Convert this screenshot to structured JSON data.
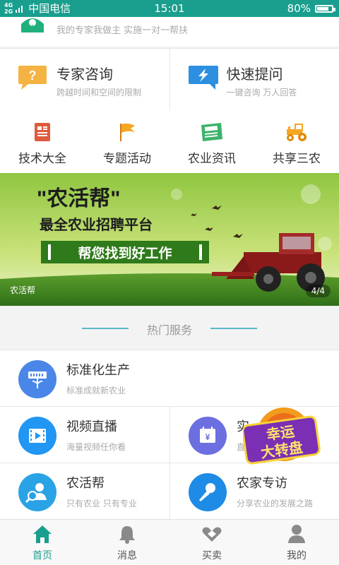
{
  "status": {
    "network": "4G",
    "network2": "2G",
    "carrier": "中国电信",
    "time": "15:01",
    "battery": "80%",
    "battery_level": 0.8
  },
  "top": {
    "slogan": "我的专家我做主 实施一对一帮扶"
  },
  "consult": [
    {
      "title": "专家咨询",
      "sub": "跨越时间和空间的限制",
      "icon": "question-chat-icon"
    },
    {
      "title": "快速提问",
      "sub": "一键咨询 万人回答",
      "icon": "lightning-chat-icon"
    }
  ],
  "categories": [
    {
      "label": "技术大全",
      "icon": "document-icon"
    },
    {
      "label": "专题活动",
      "icon": "flag-icon"
    },
    {
      "label": "农业资讯",
      "icon": "newspaper-icon"
    },
    {
      "label": "共享三农",
      "icon": "tractor-icon"
    }
  ],
  "banner": {
    "headline": "\"农活帮\"",
    "subhead": "最全农业招聘平台",
    "cta": "帮您找到好工作",
    "caption": "农活帮",
    "pager": "4/4"
  },
  "section": {
    "title": "热门服务"
  },
  "services": [
    {
      "title": "标准化生产",
      "sub": "标准成就新农业",
      "icon": "production-icon",
      "color": "#4a86e8"
    },
    {
      "title": "视频直播",
      "sub": "海量视频任你看",
      "icon": "video-icon",
      "color": "#2196f3"
    },
    {
      "title": "实",
      "sub": "直",
      "icon": "calendar-price-icon",
      "color": "#6b6fe0"
    },
    {
      "title": "农活帮",
      "sub": "只有农业 只有专业",
      "icon": "person-search-icon",
      "color": "#2aa3e6"
    },
    {
      "title": "农家专访",
      "sub": "分享农业的发展之路",
      "icon": "microphone-icon",
      "color": "#1e8be6"
    }
  ],
  "wheel": {
    "line1": "幸运",
    "line2": "大转盘"
  },
  "tabs": [
    {
      "label": "首页",
      "icon": "home-icon"
    },
    {
      "label": "消息",
      "icon": "bell-icon"
    },
    {
      "label": "买卖",
      "icon": "handshake-icon"
    },
    {
      "label": "我的",
      "icon": "user-icon"
    }
  ],
  "colors": {
    "accent": "#1a9e8e",
    "statusbar": "#1a9e8e"
  }
}
